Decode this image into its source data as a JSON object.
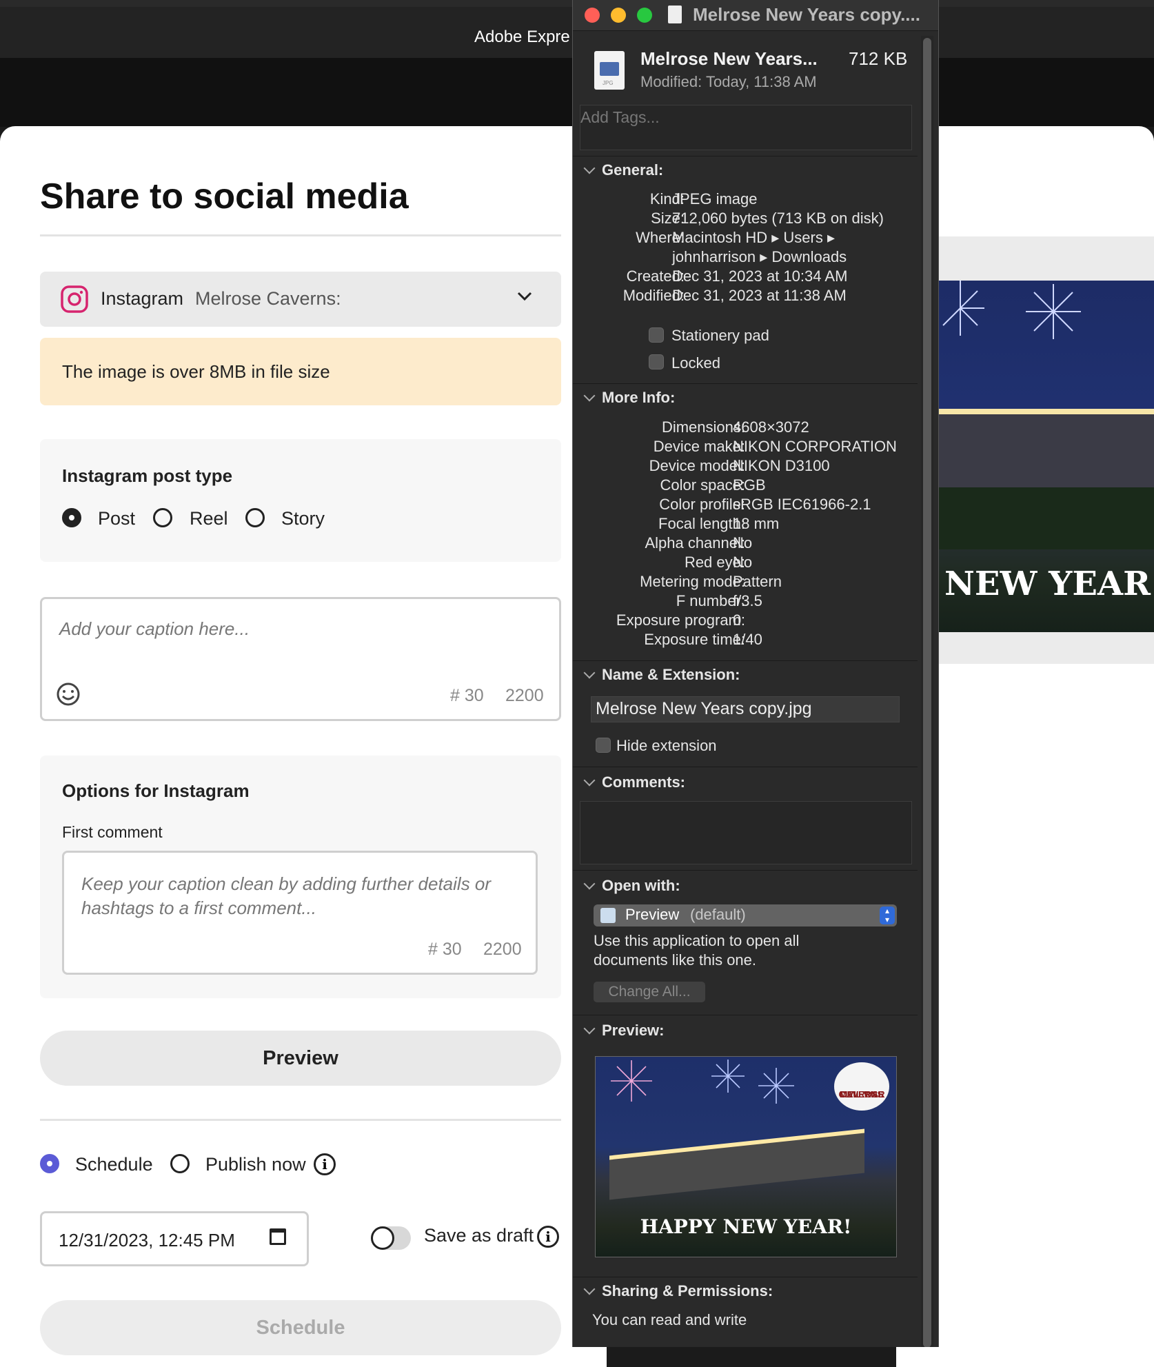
{
  "adobe": {
    "title": "Adobe Expre"
  },
  "share": {
    "title": "Share to social media",
    "account": {
      "network": "Instagram",
      "handle": "Melrose Caverns:"
    },
    "warning": "The image is over 8MB in file size",
    "post_type": {
      "title": "Instagram post type",
      "options": [
        "Post",
        "Reel",
        "Story"
      ],
      "selected": "Post"
    },
    "caption": {
      "placeholder": "Add your caption here...",
      "hashtags": "# 30",
      "chars": "2200"
    },
    "options": {
      "title": "Options for Instagram",
      "first_comment_label": "First comment",
      "first_comment_placeholder": "Keep your caption clean by adding further details or hashtags to a first comment...",
      "hashtags": "# 30",
      "chars": "2200"
    },
    "preview_label": "Preview",
    "publish": {
      "schedule_label": "Schedule",
      "publish_now_label": "Publish now",
      "selected": "Schedule"
    },
    "datetime": "12/31/2023, 12:45 PM",
    "save_draft_label": "Save as draft",
    "save_draft_on": false,
    "schedule_button": "Schedule"
  },
  "right_image": {
    "text": "NEW YEAR"
  },
  "info": {
    "window_title": "Melrose New Years copy....",
    "file_name": "Melrose New Years...",
    "file_size": "712 KB",
    "modified_label": "Modified:",
    "modified_value": "Today, 11:38 AM",
    "tags_placeholder": "Add Tags...",
    "general": {
      "title": "General:",
      "rows": [
        {
          "k": "Kind:",
          "v": "JPEG image"
        },
        {
          "k": "Size:",
          "v": "712,060 bytes (713 KB on disk)"
        },
        {
          "k": "Where:",
          "v": "Macintosh HD ▸ Users ▸"
        },
        {
          "k": "",
          "v": "johnharrison ▸ Downloads"
        },
        {
          "k": "Created:",
          "v": "Dec 31, 2023 at 10:34 AM"
        },
        {
          "k": "Modified:",
          "v": "Dec 31, 2023 at 11:38 AM"
        }
      ],
      "stationery": "Stationery pad",
      "locked": "Locked"
    },
    "more": {
      "title": "More Info:",
      "rows": [
        {
          "k": "Dimensions:",
          "v": "4608×3072"
        },
        {
          "k": "Device make:",
          "v": "NIKON CORPORATION"
        },
        {
          "k": "Device model:",
          "v": "NIKON D3100"
        },
        {
          "k": "Color space:",
          "v": "RGB"
        },
        {
          "k": "Color profile:",
          "v": "sRGB IEC61966-2.1"
        },
        {
          "k": "Focal length:",
          "v": "18 mm"
        },
        {
          "k": "Alpha channel:",
          "v": "No"
        },
        {
          "k": "Red eye:",
          "v": "No"
        },
        {
          "k": "Metering mode:",
          "v": "Pattern"
        },
        {
          "k": "F number:",
          "v": "f/3.5"
        },
        {
          "k": "Exposure program:",
          "v": "0"
        },
        {
          "k": "Exposure time:",
          "v": "1/40"
        }
      ]
    },
    "name_ext": {
      "title": "Name & Extension:",
      "value": "Melrose New Years copy.jpg",
      "hide_ext": "Hide extension"
    },
    "comments": {
      "title": "Comments:"
    },
    "open_with": {
      "title": "Open with:",
      "app": "Preview",
      "app_default": "(default)",
      "description": "Use this application to open all documents like this one.",
      "change_all": "Change All..."
    },
    "preview": {
      "title": "Preview:",
      "image_text": "HAPPY NEW YEAR!",
      "logo_line1": "MELROSE",
      "logo_line2": "CIVIL WAR",
      "logo_line3": "CAVERNS"
    },
    "sharing": {
      "title": "Sharing & Permissions:",
      "text": "You can read and write"
    }
  },
  "colors": {
    "accent": "#5b5bd6",
    "warning_bg": "#fdebcc",
    "close": "#ff5f57",
    "minimize": "#febc2e",
    "zoom": "#28c840"
  }
}
